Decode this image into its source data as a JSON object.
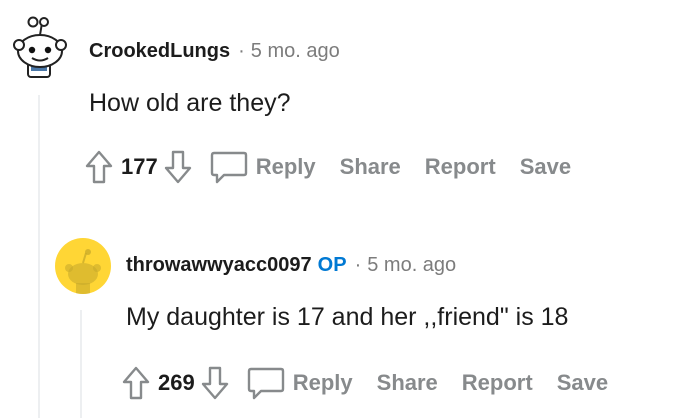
{
  "comments": [
    {
      "username": "CrookedLungs",
      "separator": "·",
      "timestamp": "5 mo. ago",
      "body": "How old are they?",
      "score": "177",
      "actions": {
        "reply": "Reply",
        "share": "Share",
        "report": "Report",
        "save": "Save"
      }
    },
    {
      "username": "throwawwyacc0097",
      "badge": "OP",
      "separator": "·",
      "timestamp": "5 mo. ago",
      "body": "My daughter is 17 and her ,,friend\" is 18",
      "score": "269",
      "actions": {
        "reply": "Reply",
        "share": "Share",
        "report": "Report",
        "save": "Save"
      }
    }
  ],
  "colors": {
    "op_badge": "#0079d3",
    "action_text": "#878a8c",
    "meta_text": "#7c7c7c",
    "thread_line": "#edeff1",
    "reply_avatar_bg": "#ffd635"
  },
  "icons": {
    "upvote": "arrow-up-icon",
    "downvote": "arrow-down-icon",
    "reply": "speech-bubble-icon"
  }
}
